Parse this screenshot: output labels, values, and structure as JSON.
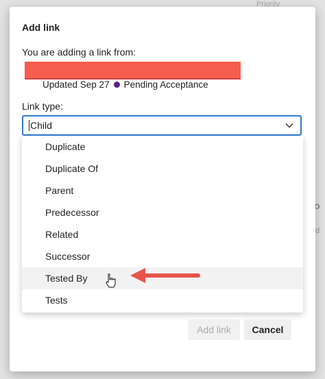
{
  "background": {
    "priority_label": "Priority",
    "frag1": "o",
    "frag2": "d"
  },
  "dialog": {
    "title": "Add link",
    "from_label": "You are adding a link from:",
    "meta_updated": "Updated Sep 27",
    "meta_status": "Pending Acceptance",
    "status_color": "#5a1e89",
    "link_type_label": "Link type:",
    "link_type_value": "Child",
    "options": [
      "Duplicate",
      "Duplicate Of",
      "Parent",
      "Predecessor",
      "Related",
      "Successor",
      "Tested By",
      "Tests"
    ],
    "hovered_option": "Tested By",
    "add_link_button": "Add link",
    "cancel_button": "Cancel"
  },
  "colors": {
    "focus_border": "#2d7bd6",
    "redaction": "#f55d4f",
    "arrow": "#e8544a"
  }
}
